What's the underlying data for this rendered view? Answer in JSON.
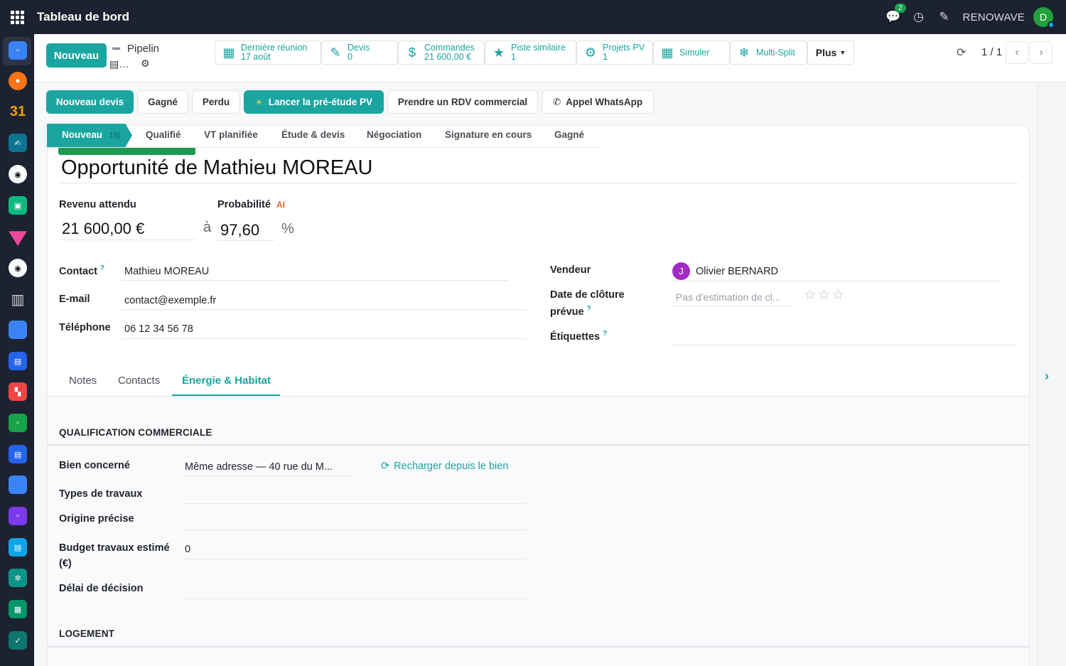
{
  "navbar": {
    "title": "Tableau de bord",
    "chat_badge": "2",
    "company": "RENOWAVE",
    "user_initial": "D"
  },
  "control": {
    "new_button": "Nouveau",
    "breadcrumb": "Pipelin",
    "record_short": "…",
    "smart_buttons": [
      {
        "icon": "calendar-icon",
        "label": "Dernière réunion",
        "value": "17 août"
      },
      {
        "icon": "edit-icon",
        "label": "Devis",
        "value": "0"
      },
      {
        "icon": "dollar-icon",
        "label": "Commandes",
        "value": "21 600,00 €"
      },
      {
        "icon": "star-icon",
        "label": "Piste similaire",
        "value": "1"
      },
      {
        "icon": "gear-icon",
        "label": "Projets PV",
        "value": "1"
      },
      {
        "icon": "calculator-icon",
        "label": "Simuler",
        "value": ""
      },
      {
        "icon": "snowflake-icon",
        "label": "Multi-Split",
        "value": ""
      }
    ],
    "more": "Plus",
    "pager": "1 / 1"
  },
  "actions": {
    "new_quote": "Nouveau devis",
    "won": "Gagné",
    "lost": "Perdu",
    "launch_study": "Lancer la pré-étude PV",
    "book_meeting": "Prendre un RDV commercial",
    "whatsapp": "Appel WhatsApp"
  },
  "stages": {
    "active": "Nouveau",
    "active_days": "19j",
    "items": [
      "Qualifié",
      "VT planifiée",
      "Étude & devis",
      "Négociation",
      "Signature en cours",
      "Gagné"
    ]
  },
  "form": {
    "title": "Opportunité de Mathieu MOREAU",
    "expected_revenue_label": "Revenu attendu",
    "expected_revenue": "21 600,00 €",
    "at": "à",
    "probability_label": "Probabilité",
    "ai_badge": "AI",
    "probability": "97,60",
    "percent": "%",
    "contact_label": "Contact",
    "contact": "Mathieu MOREAU",
    "email_label": "E-mail",
    "email": "contact@exemple.fr",
    "phone_label": "Téléphone",
    "phone": "06 12 34 56 78",
    "salesperson_label": "Vendeur",
    "salesperson_initial": "J",
    "salesperson": "Olivier BERNARD",
    "close_date_label_1": "Date de clôture",
    "close_date_label_2": "prévue",
    "close_date_placeholder": "Pas d'estimation de cl...",
    "tags_label": "Étiquettes",
    "help_mark": "?"
  },
  "tabs": [
    "Notes",
    "Contacts",
    "Énergie & Habitat"
  ],
  "energy": {
    "section1": "QUALIFICATION COMMERCIALE",
    "property_label": "Bien concerné",
    "property_value": "Même adresse — 40 rue du M...",
    "reload": "Recharger depuis le bien",
    "works_type_label": "Types de travaux",
    "origin_label": "Origine précise",
    "budget_label_1": "Budget travaux estimé",
    "budget_label_2": "(€)",
    "budget_value": "0",
    "decision_label": "Délai de décision",
    "section2": "LOGEMENT"
  },
  "colors": {
    "primary": "#1aa5a0",
    "navbar": "#1c2230",
    "ribbon": "#1e9a52",
    "vendor_avatar": "#a02cc4"
  }
}
